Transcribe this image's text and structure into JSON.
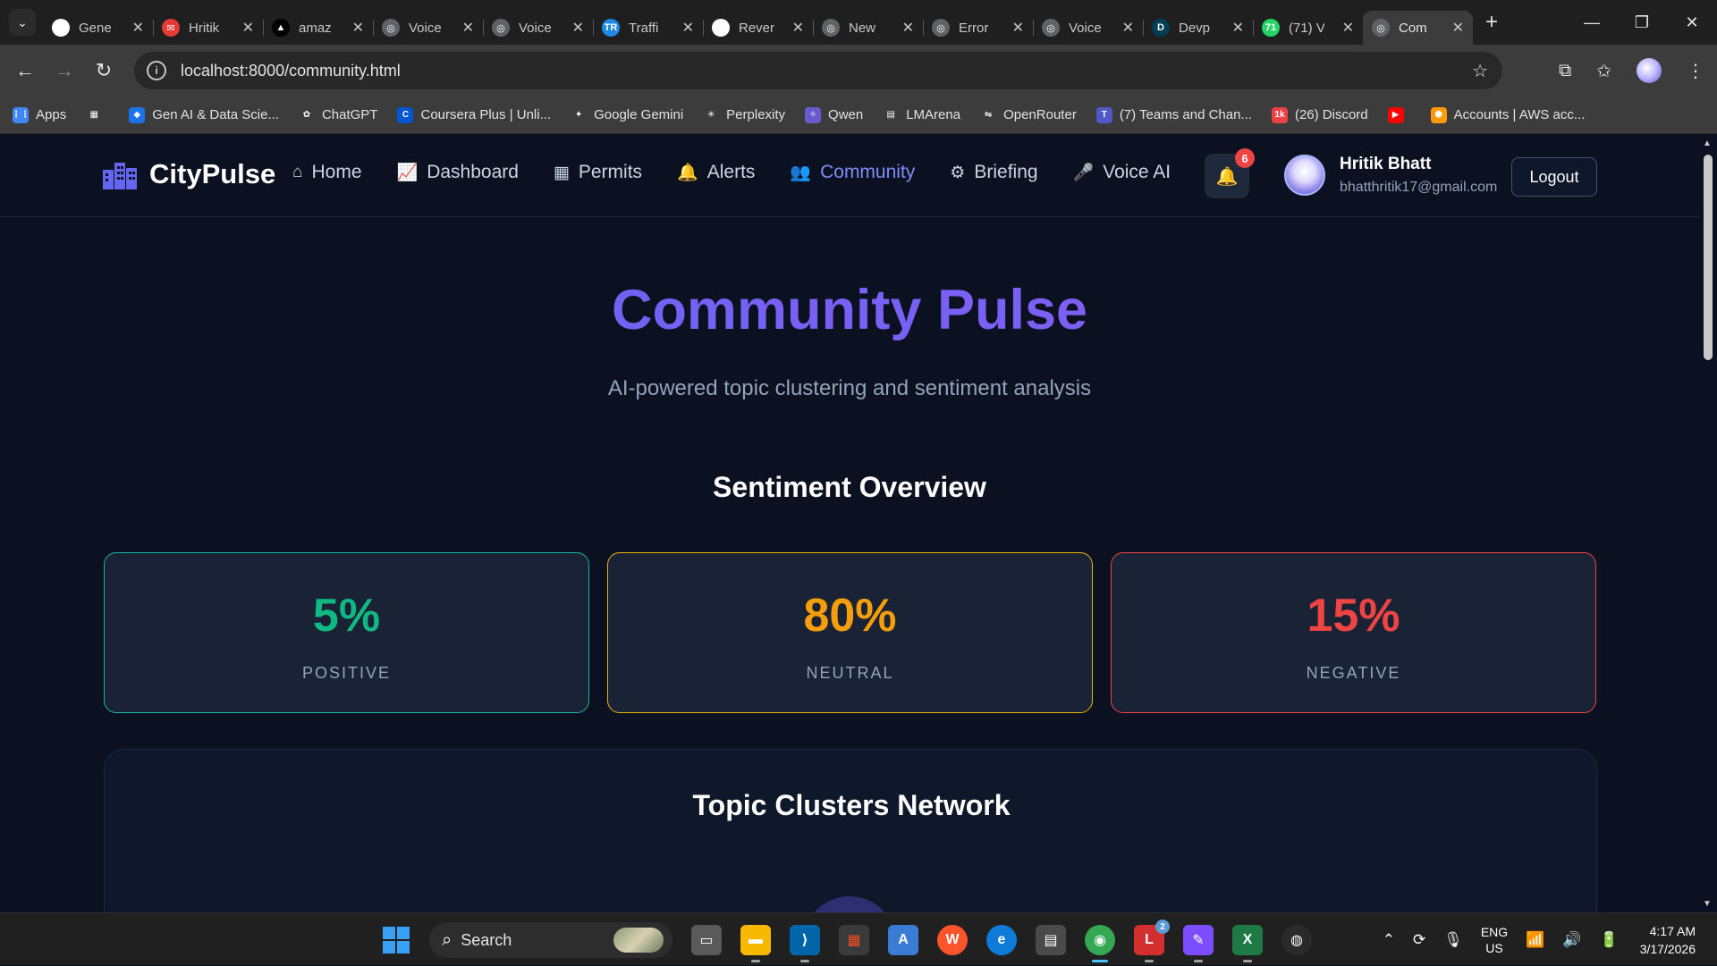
{
  "browser": {
    "tabs": [
      {
        "title": "Gene",
        "icon": "github-icon",
        "color": "#ffffff",
        "glyph": "◉"
      },
      {
        "title": "Hritik",
        "icon": "email-icon",
        "color": "#e53935",
        "glyph": "✉"
      },
      {
        "title": "amaz",
        "icon": "triangle-logo-icon",
        "color": "#000000",
        "glyph": "▲"
      },
      {
        "title": "Voice",
        "icon": "globe-icon",
        "color": "#5f6368",
        "glyph": "◎"
      },
      {
        "title": "Voice",
        "icon": "globe-icon",
        "color": "#5f6368",
        "glyph": "◎"
      },
      {
        "title": "Traffi",
        "icon": "traffic-icon",
        "color": "#1e88e5",
        "glyph": "TR"
      },
      {
        "title": "Rever",
        "icon": "chatgpt-icon",
        "color": "#ffffff",
        "glyph": "✿"
      },
      {
        "title": "New",
        "icon": "globe-icon",
        "color": "#5f6368",
        "glyph": "◎"
      },
      {
        "title": "Error",
        "icon": "globe-icon",
        "color": "#5f6368",
        "glyph": "◎"
      },
      {
        "title": "Voice",
        "icon": "globe-icon",
        "color": "#5f6368",
        "glyph": "◎"
      },
      {
        "title": "Devp",
        "icon": "devpost-icon",
        "color": "#003e54",
        "glyph": "D"
      },
      {
        "title": "(71) V",
        "icon": "whatsapp-icon",
        "color": "#25d366",
        "glyph": "71"
      },
      {
        "title": "Com",
        "icon": "globe-icon",
        "color": "#5f6368",
        "glyph": "◎",
        "active": true
      }
    ],
    "url": "localhost:8000/community.html",
    "bookmarks": [
      {
        "label": "Apps",
        "icon": "apps-grid-icon",
        "color": "#4285f4",
        "glyph": "⋮⋮"
      },
      {
        "label": "",
        "icon": "tab-groups-icon",
        "color": "#3c3c3c",
        "glyph": "▦"
      },
      {
        "label": "Gen AI & Data Scie...",
        "icon": "bookmark-blue-icon",
        "color": "#1a73e8",
        "glyph": "◆"
      },
      {
        "label": "ChatGPT",
        "icon": "chatgpt-icon",
        "color": "#3c3c3c",
        "glyph": "✿"
      },
      {
        "label": "Coursera Plus | Unli...",
        "icon": "coursera-icon",
        "color": "#0056d2",
        "glyph": "C"
      },
      {
        "label": "Google Gemini",
        "icon": "gemini-icon",
        "color": "#3c3c3c",
        "glyph": "✦"
      },
      {
        "label": "Perplexity",
        "icon": "perplexity-icon",
        "color": "#3c3c3c",
        "glyph": "✳"
      },
      {
        "label": "Qwen",
        "icon": "qwen-icon",
        "color": "#6a5acd",
        "glyph": "✧"
      },
      {
        "label": "LMArena",
        "icon": "lmarena-icon",
        "color": "#3c3c3c",
        "glyph": "▤"
      },
      {
        "label": "OpenRouter",
        "icon": "openrouter-icon",
        "color": "#3c3c3c",
        "glyph": "⇋"
      },
      {
        "label": "(7) Teams and Chan...",
        "icon": "teams-icon",
        "color": "#5059c9",
        "glyph": "T"
      },
      {
        "label": "(26) Discord",
        "icon": "discord-icon",
        "color": "#ed4245",
        "glyph": "1k"
      },
      {
        "label": "",
        "icon": "youtube-icon",
        "color": "#ff0000",
        "glyph": "▶"
      },
      {
        "label": "Accounts | AWS acc...",
        "icon": "aws-icon",
        "color": "#ff9900",
        "glyph": "⬢"
      }
    ]
  },
  "app": {
    "brand": "CityPulse",
    "nav": [
      {
        "label": "Home",
        "icon": "home-icon",
        "glyph": "⌂"
      },
      {
        "label": "Dashboard",
        "icon": "chart-line-icon",
        "glyph": "📈"
      },
      {
        "label": "Permits",
        "icon": "building-icon",
        "glyph": "▦"
      },
      {
        "label": "Alerts",
        "icon": "bell-icon",
        "glyph": "🔔"
      },
      {
        "label": "Community",
        "icon": "users-icon",
        "glyph": "👥",
        "active": true
      },
      {
        "label": "Briefing",
        "icon": "gear-icon",
        "glyph": "⚙"
      },
      {
        "label": "Voice AI",
        "icon": "microphone-icon",
        "glyph": "🎤"
      }
    ],
    "notifications_count": "6",
    "user": {
      "name": "Hritik Bhatt",
      "email": "bhatthritik17@gmail.com"
    },
    "logout_label": "Logout"
  },
  "page": {
    "title": "Community Pulse",
    "subtitle": "AI-powered topic clustering and sentiment analysis",
    "sentiment_heading": "Sentiment Overview",
    "sentiment": [
      {
        "value": "5%",
        "label": "POSITIVE",
        "color": "#10b981",
        "border": "#14b8a6"
      },
      {
        "value": "80%",
        "label": "NEUTRAL",
        "color": "#f59e0b",
        "border": "#eab308"
      },
      {
        "value": "15%",
        "label": "NEGATIVE",
        "color": "#ef4444",
        "border": "#ef4444"
      }
    ],
    "clusters_heading": "Topic Clusters Network"
  },
  "taskbar": {
    "search_label": "Search",
    "lang": "ENG",
    "region": "US",
    "time": "4:17 AM",
    "date": "3/17/2026",
    "badge_count": "2"
  }
}
